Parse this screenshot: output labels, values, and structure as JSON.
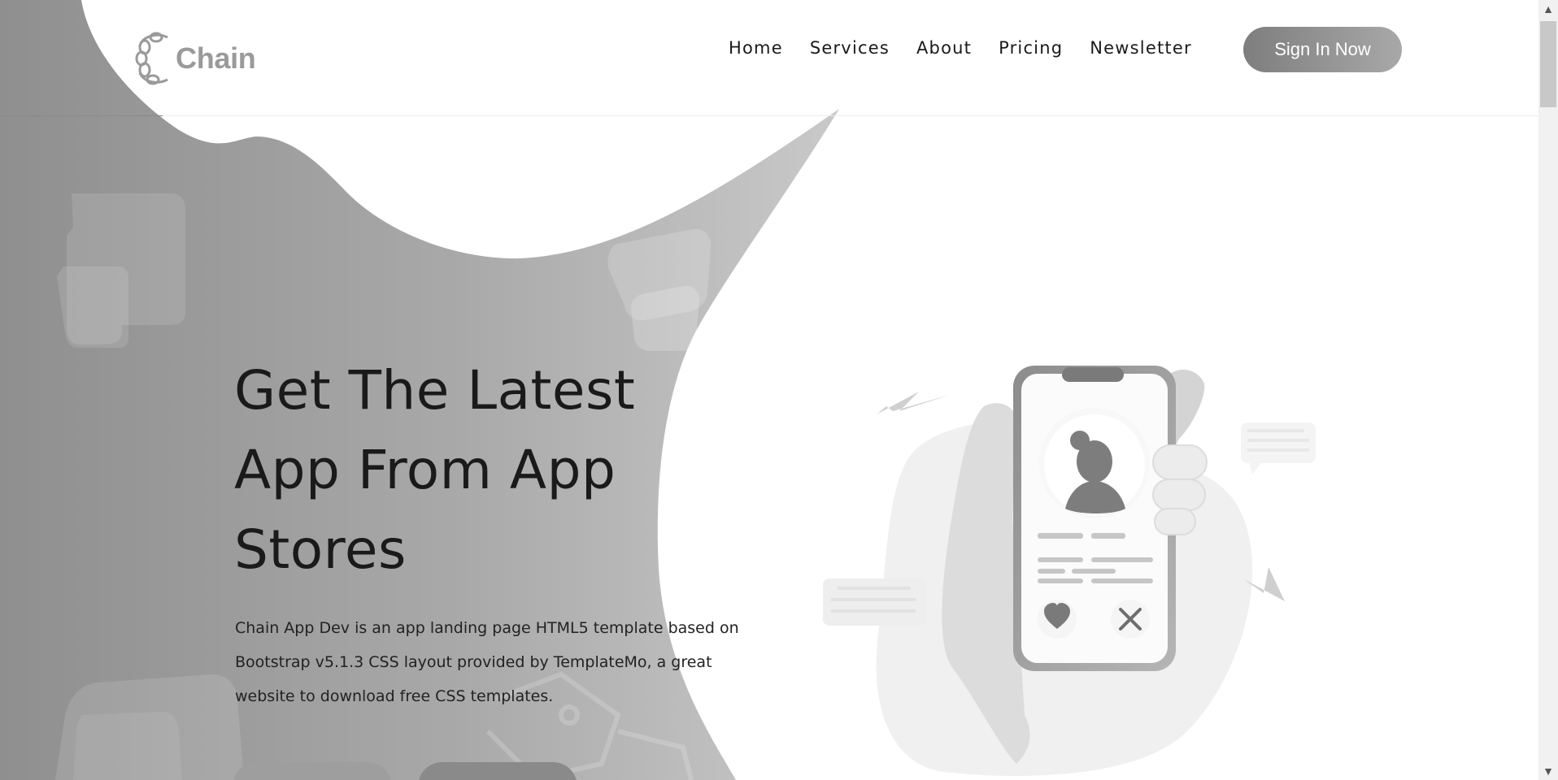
{
  "header": {
    "logo_text": "Chain",
    "nav": [
      "Home",
      "Services",
      "About",
      "Pricing",
      "Newsletter"
    ],
    "signin_label": "Sign In Now"
  },
  "hero": {
    "title_lines": [
      "Get The Latest",
      "App From App",
      "Stores"
    ],
    "description": "Chain App Dev is an app landing page HTML5 template based on Bootstrap v5.1.3 CSS layout provided by TemplateMo, a great website to download free CSS templates."
  },
  "scrollbar": {
    "up_icon": "▲",
    "down_icon": "▼"
  },
  "colors": {
    "accent_gray": "#9e9e9e",
    "dark_text": "#1a1a1a"
  }
}
